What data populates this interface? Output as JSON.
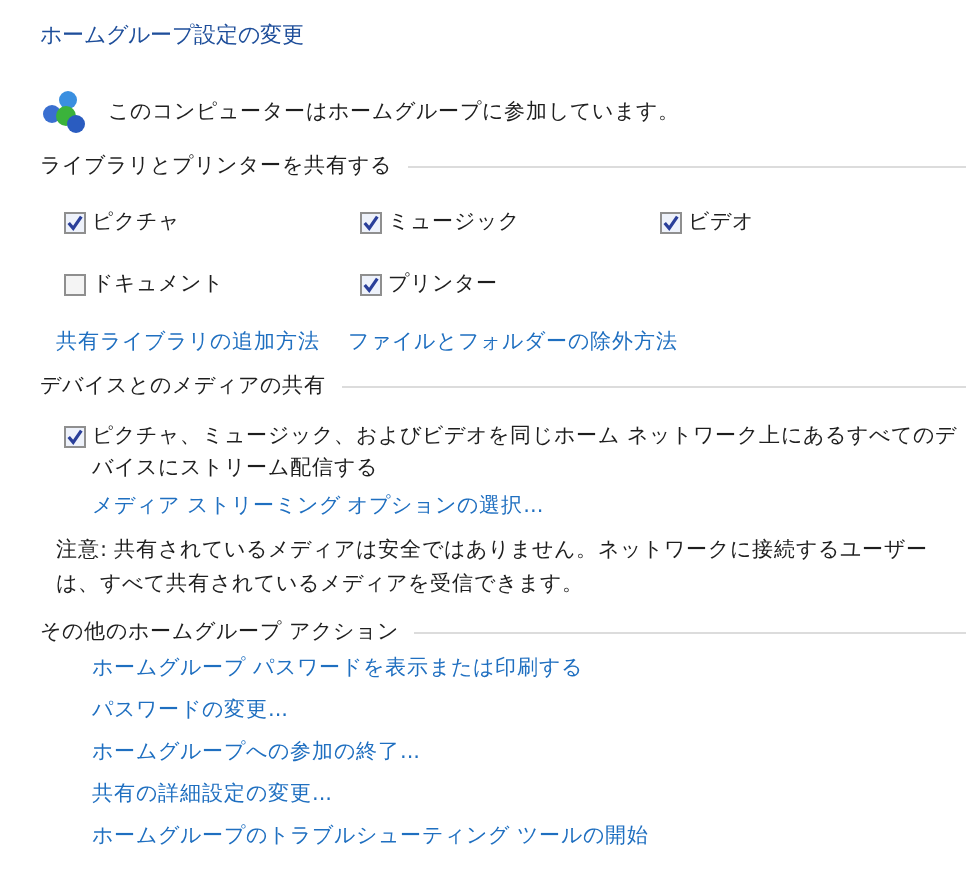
{
  "title": "ホームグループ設定の変更",
  "status": {
    "text": "このコンピューターはホームグループに参加しています。"
  },
  "share_section": {
    "heading": "ライブラリとプリンターを共有する",
    "items": [
      {
        "label": "ピクチャ",
        "checked": true
      },
      {
        "label": "ミュージック",
        "checked": true
      },
      {
        "label": "ビデオ",
        "checked": true
      },
      {
        "label": "ドキュメント",
        "checked": false
      },
      {
        "label": "プリンター",
        "checked": true
      }
    ],
    "links": [
      "共有ライブラリの追加方法",
      "ファイルとフォルダーの除外方法"
    ]
  },
  "media_section": {
    "heading": "デバイスとのメディアの共有",
    "stream": {
      "label": "ピクチャ、ミュージック、およびビデオを同じホーム ネットワーク上にあるすべてのデバイスにストリーム配信する",
      "checked": true
    },
    "link": "メディア ストリーミング オプションの選択...",
    "note": "注意: 共有されているメディアは安全ではありません。ネットワークに接続するユーザーは、すべて共有されているメディアを受信できます。"
  },
  "other_section": {
    "heading": "その他のホームグループ アクション",
    "links": [
      "ホームグループ パスワードを表示または印刷する",
      "パスワードの変更...",
      "ホームグループへの参加の終了...",
      "共有の詳細設定の変更...",
      "ホームグループのトラブルシューティング ツールの開始"
    ]
  }
}
